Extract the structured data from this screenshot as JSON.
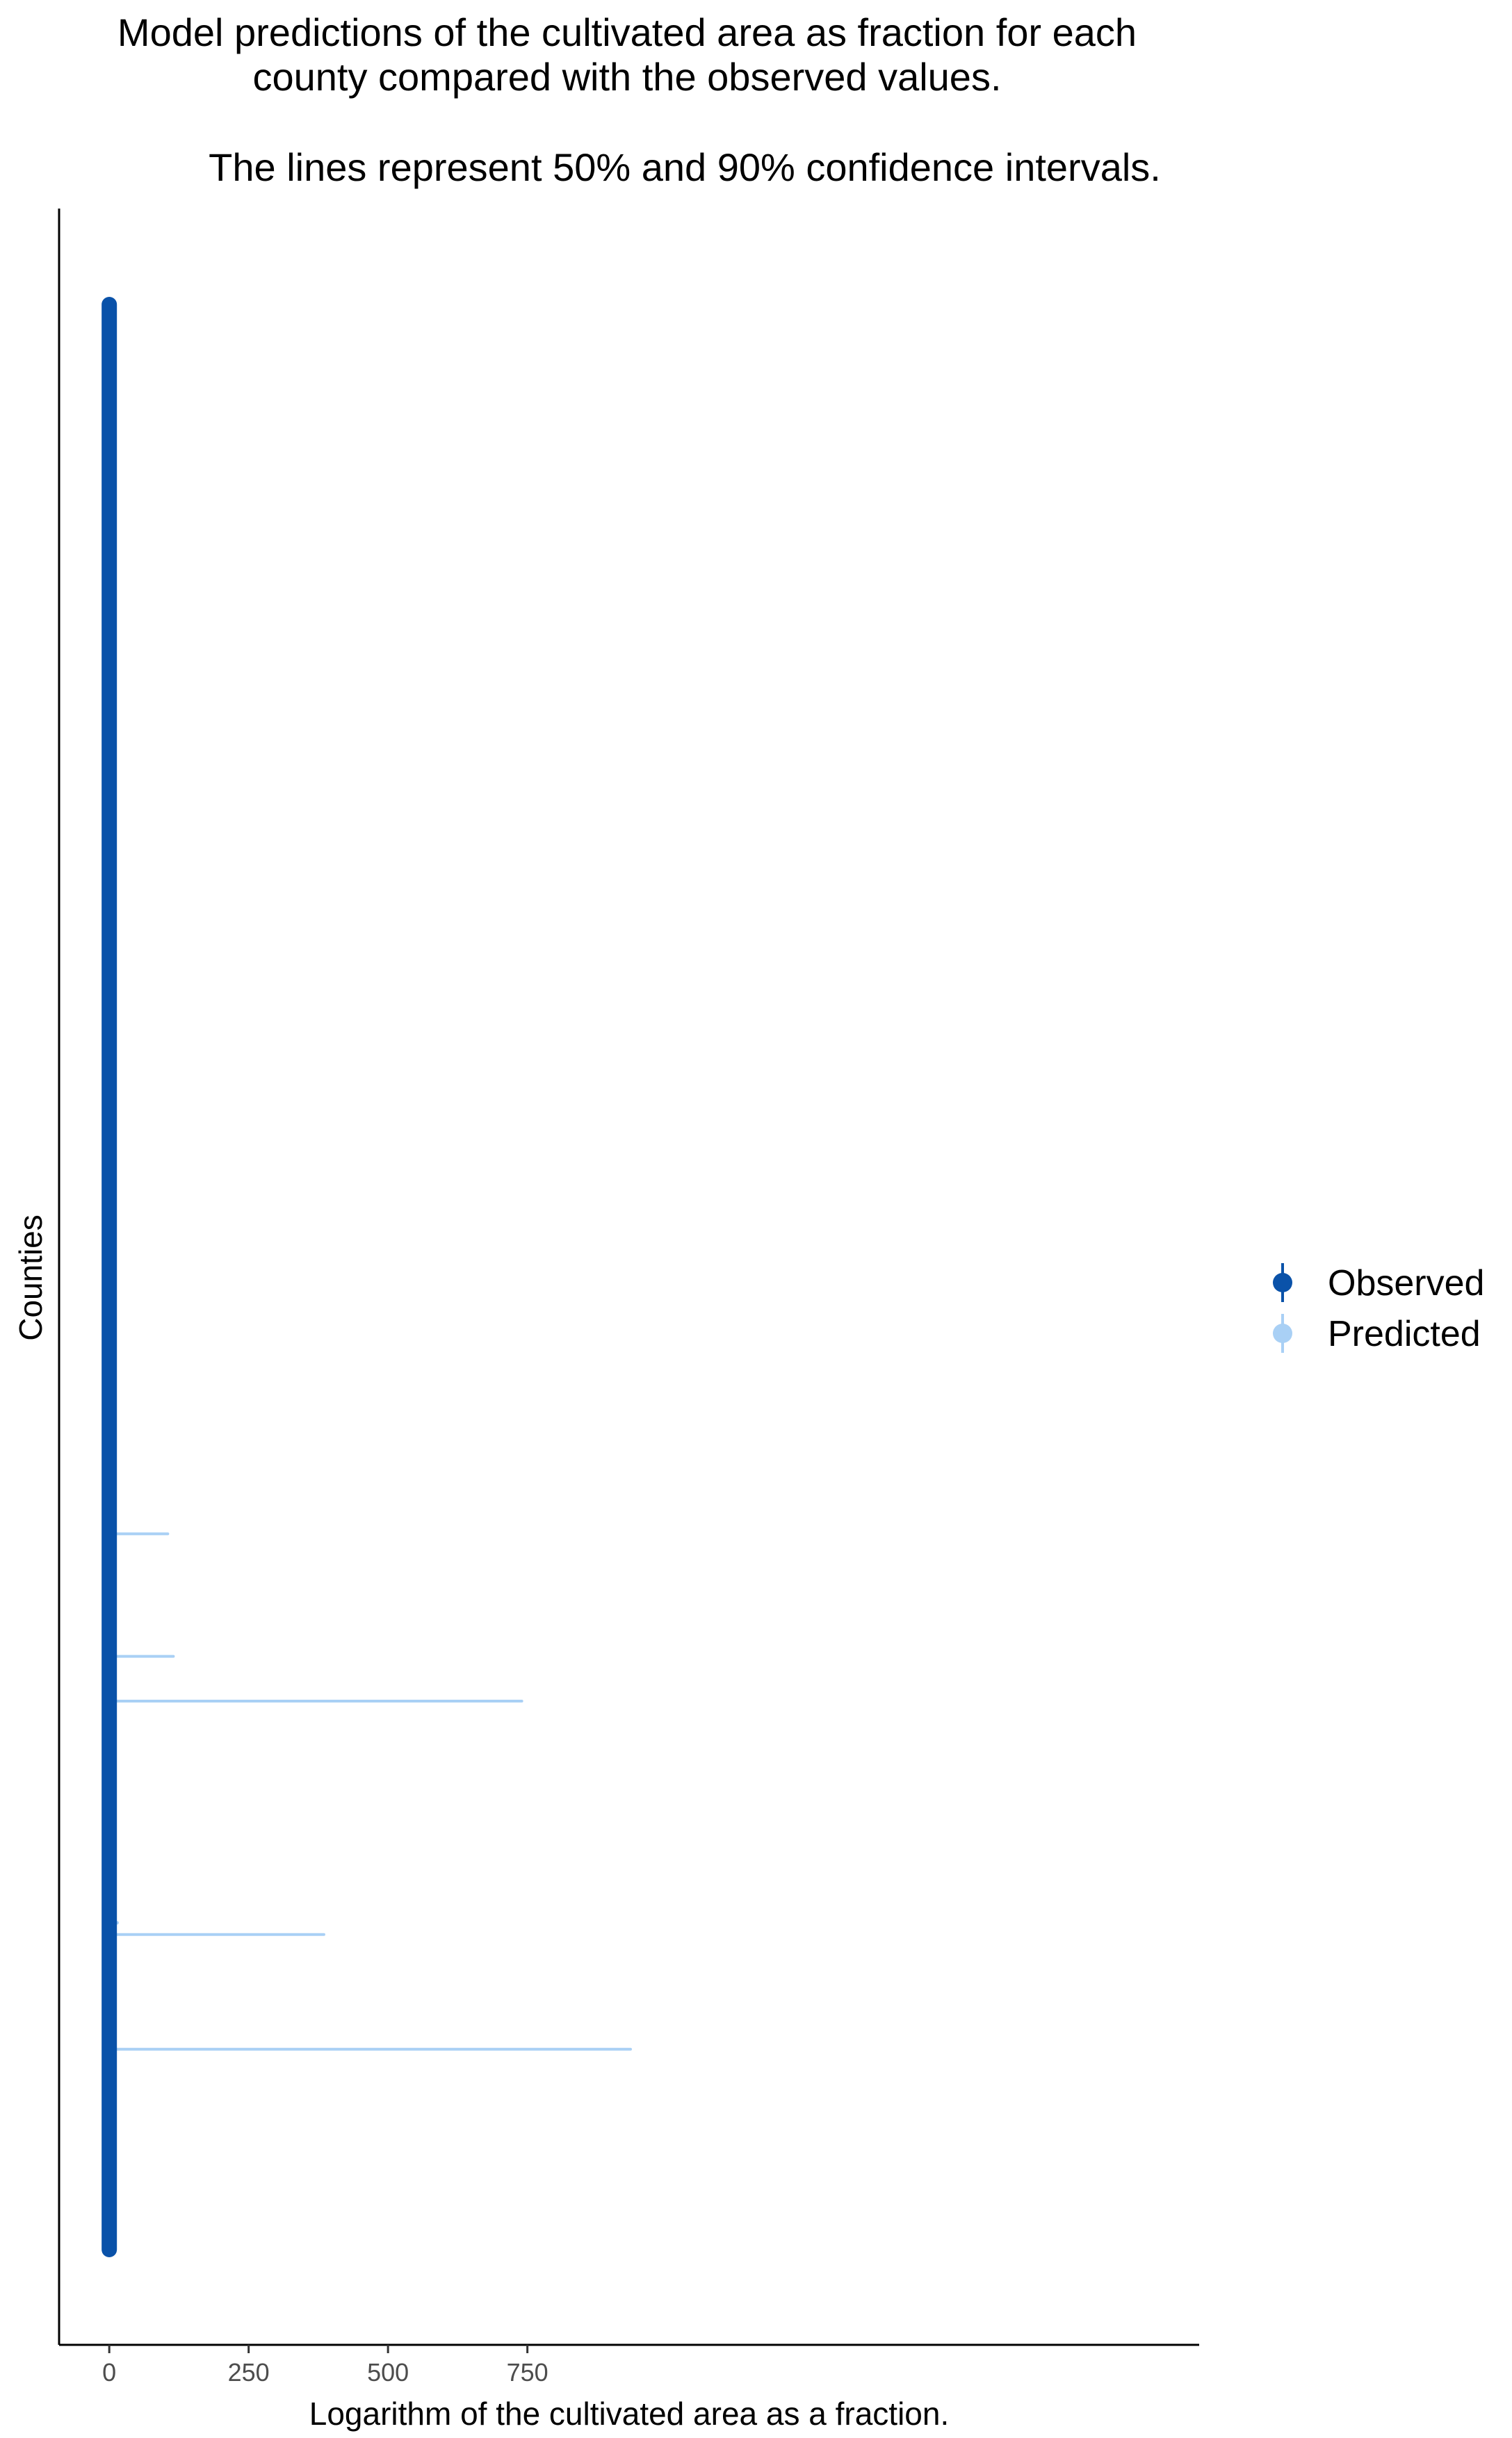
{
  "chart_data": {
    "type": "scatter",
    "title_lines": [
      "Model predictions of the cultivated area as fraction for each",
      "county compared with the observed values."
    ],
    "subtitle": "The lines represent 50% and 90% confidence intervals.",
    "xlabel": "Logarithm of the cultivated area as a fraction.",
    "ylabel": "Counties",
    "xlim": [
      -90,
      1955
    ],
    "x_ticks": [
      0,
      250,
      500,
      750
    ],
    "grid": false,
    "legend": {
      "placement": "right",
      "entries": [
        {
          "label": "Observed",
          "color": "#0a52a9"
        },
        {
          "label": "Predicted",
          "color": "#a9d0f5"
        }
      ]
    },
    "observed_span": {
      "x": 0,
      "y_range": [
        0,
        100
      ],
      "color": "#0a52a9"
    },
    "predicted_intervals": [
      {
        "county_position": 36.8,
        "ci90": [
          0,
          105
        ]
      },
      {
        "county_position": 30.5,
        "ci90": [
          0,
          115
        ]
      },
      {
        "county_position": 28.2,
        "ci90": [
          0,
          740
        ]
      },
      {
        "county_position": 16.8,
        "ci50": [
          0,
          14
        ]
      },
      {
        "county_position": 16.2,
        "ci90": [
          0,
          385
        ]
      },
      {
        "county_position": 10.3,
        "ci90": [
          0,
          935
        ]
      }
    ],
    "colors": {
      "observed": "#0a52a9",
      "predicted": "#a9d0f5",
      "axis": "#000000",
      "tick_label": "#4d4d4d"
    }
  }
}
